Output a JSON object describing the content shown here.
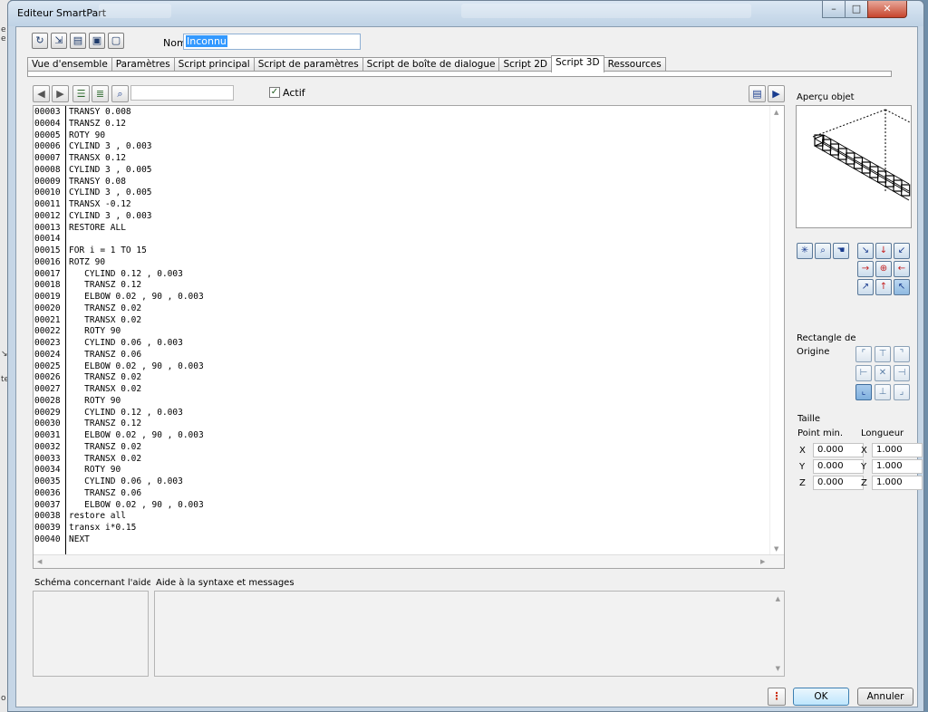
{
  "window": {
    "title": "Editeur SmartPart",
    "controls": {
      "minimize": "–",
      "maximize": "□",
      "close": "✕"
    }
  },
  "header": {
    "nom_label": "Nom",
    "nom_value": "Inconnu"
  },
  "tabs": [
    {
      "label": "Vue d'ensemble",
      "active": false
    },
    {
      "label": "Paramètres",
      "active": false
    },
    {
      "label": "Script principal",
      "active": false
    },
    {
      "label": "Script de paramètres",
      "active": false
    },
    {
      "label": "Script de boîte de dialogue",
      "active": false
    },
    {
      "label": "Script 2D",
      "active": false
    },
    {
      "label": "Script 3D",
      "active": true
    },
    {
      "label": "Ressources",
      "active": false
    }
  ],
  "editor_toolbar": {
    "search_value": "",
    "actif_label": "Actif",
    "actif_checked": true
  },
  "code": {
    "lines": [
      {
        "n": "00003",
        "t": "TRANSY 0.008"
      },
      {
        "n": "00004",
        "t": "TRANSZ 0.12"
      },
      {
        "n": "00005",
        "t": "ROTY 90"
      },
      {
        "n": "00006",
        "t": "CYLIND 3 , 0.003"
      },
      {
        "n": "00007",
        "t": "TRANSX 0.12"
      },
      {
        "n": "00008",
        "t": "CYLIND 3 , 0.005"
      },
      {
        "n": "00009",
        "t": "TRANSY 0.08"
      },
      {
        "n": "00010",
        "t": "CYLIND 3 , 0.005"
      },
      {
        "n": "00011",
        "t": "TRANSX -0.12"
      },
      {
        "n": "00012",
        "t": "CYLIND 3 , 0.003"
      },
      {
        "n": "00013",
        "t": "RESTORE ALL"
      },
      {
        "n": "00014",
        "t": ""
      },
      {
        "n": "00015",
        "t": "FOR i = 1 TO 15"
      },
      {
        "n": "00016",
        "t": "ROTZ 90"
      },
      {
        "n": "00017",
        "t": "   CYLIND 0.12 , 0.003"
      },
      {
        "n": "00018",
        "t": "   TRANSZ 0.12"
      },
      {
        "n": "00019",
        "t": "   ELBOW 0.02 , 90 , 0.003"
      },
      {
        "n": "00020",
        "t": "   TRANSZ 0.02"
      },
      {
        "n": "00021",
        "t": "   TRANSX 0.02"
      },
      {
        "n": "00022",
        "t": "   ROTY 90"
      },
      {
        "n": "00023",
        "t": "   CYLIND 0.06 , 0.003"
      },
      {
        "n": "00024",
        "t": "   TRANSZ 0.06"
      },
      {
        "n": "00025",
        "t": "   ELBOW 0.02 , 90 , 0.003"
      },
      {
        "n": "00026",
        "t": "   TRANSZ 0.02"
      },
      {
        "n": "00027",
        "t": "   TRANSX 0.02"
      },
      {
        "n": "00028",
        "t": "   ROTY 90"
      },
      {
        "n": "00029",
        "t": "   CYLIND 0.12 , 0.003"
      },
      {
        "n": "00030",
        "t": "   TRANSZ 0.12"
      },
      {
        "n": "00031",
        "t": "   ELBOW 0.02 , 90 , 0.003"
      },
      {
        "n": "00032",
        "t": "   TRANSZ 0.02"
      },
      {
        "n": "00033",
        "t": "   TRANSX 0.02"
      },
      {
        "n": "00034",
        "t": "   ROTY 90"
      },
      {
        "n": "00035",
        "t": "   CYLIND 0.06 , 0.003"
      },
      {
        "n": "00036",
        "t": "   TRANSZ 0.06"
      },
      {
        "n": "00037",
        "t": "   ELBOW 0.02 , 90 , 0.003"
      },
      {
        "n": "00038",
        "t": "restore all"
      },
      {
        "n": "00039",
        "t": "transx i*0.15"
      },
      {
        "n": "00040",
        "t": "NEXT"
      }
    ]
  },
  "panes": {
    "schema_label": "Schéma concernant l'aide à la",
    "help_label": "Aide à la syntaxe et messages"
  },
  "right": {
    "apercu_label": "Aperçu objet",
    "rectangle_label": "Rectangle de",
    "origine_label": "Origine",
    "taille_label": "Taille",
    "point_min_label": "Point min.",
    "longueur_label": "Longueur",
    "axes": [
      "X",
      "Y",
      "Z"
    ],
    "point_min": [
      "0.000",
      "0.000",
      "0.000"
    ],
    "longueur": [
      "1.000",
      "1.000",
      "1.000"
    ],
    "origin_selected": "bottom-left"
  },
  "footer": {
    "help_symbol": "⋮",
    "ok_label": "OK",
    "cancel_label": "Annuler"
  },
  "colors": {
    "selection": "#3399ff",
    "window_frame": "#c6d6e6",
    "dialog_bg": "#f0f0f0",
    "nav_arrow": "#1a3d8f"
  }
}
